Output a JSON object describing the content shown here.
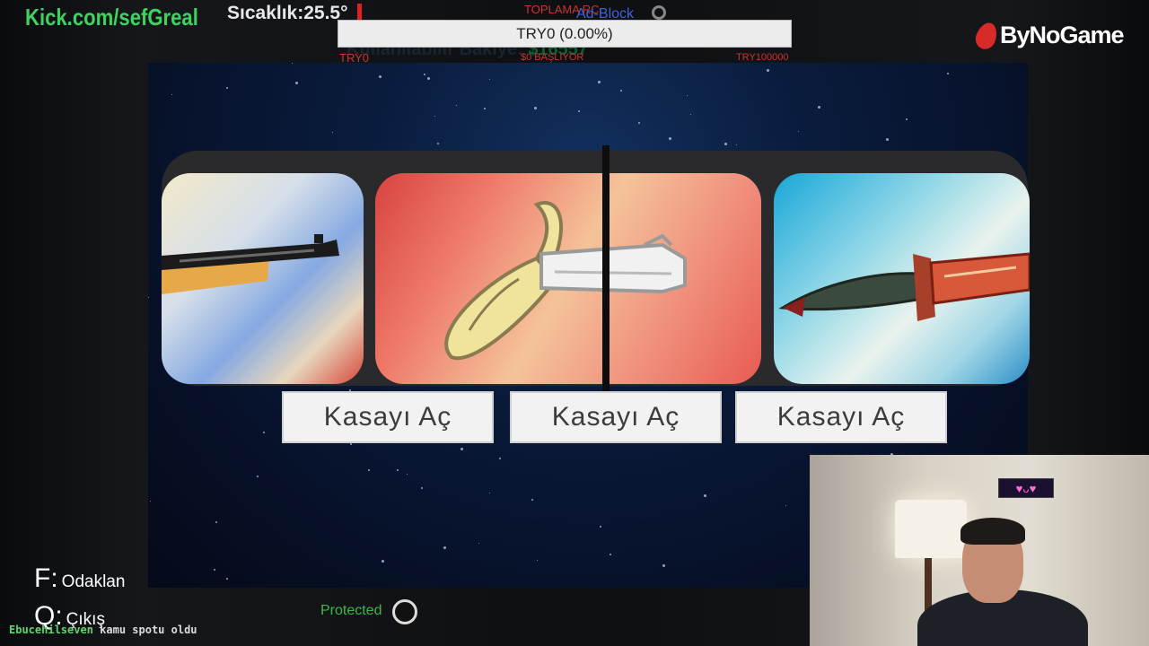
{
  "overlay": {
    "kick_url": "Kick.com/sefGreal",
    "temperature": "Sıcaklık:25.5°",
    "toplama": "TOPLAMA RC",
    "adblock": "Ad-Block",
    "progress_text": "TRY0 (0.00%)",
    "progress_fraction": 0.0,
    "progress_min": "TRY0",
    "progress_max": "TRY100000",
    "balance_label": "Kullanılabilir Bakiye:",
    "balance_value": "$16557",
    "bar_mid": "$0 BAŞLIYOR",
    "brand": "ByNoGame",
    "protected": "Protected",
    "ticker_user": "Ebucehilseven",
    "ticker_text": "kamu spotu oldu"
  },
  "game": {
    "cards": [
      {
        "name": "rifle",
        "icon": "rifle-icon"
      },
      {
        "name": "banana-pistol",
        "icon": "banana-pistol-icon"
      },
      {
        "name": "dagger",
        "icon": "dagger-icon"
      }
    ],
    "buttons": [
      "Kasayı Aç",
      "Kasayı Aç",
      "Kasayı Aç"
    ]
  },
  "hints": [
    {
      "key": "F:",
      "label": "Odaklan"
    },
    {
      "key": "Q:",
      "label": "Çıkış"
    }
  ],
  "webcam": {
    "sign": "♥ᴗ♥"
  }
}
